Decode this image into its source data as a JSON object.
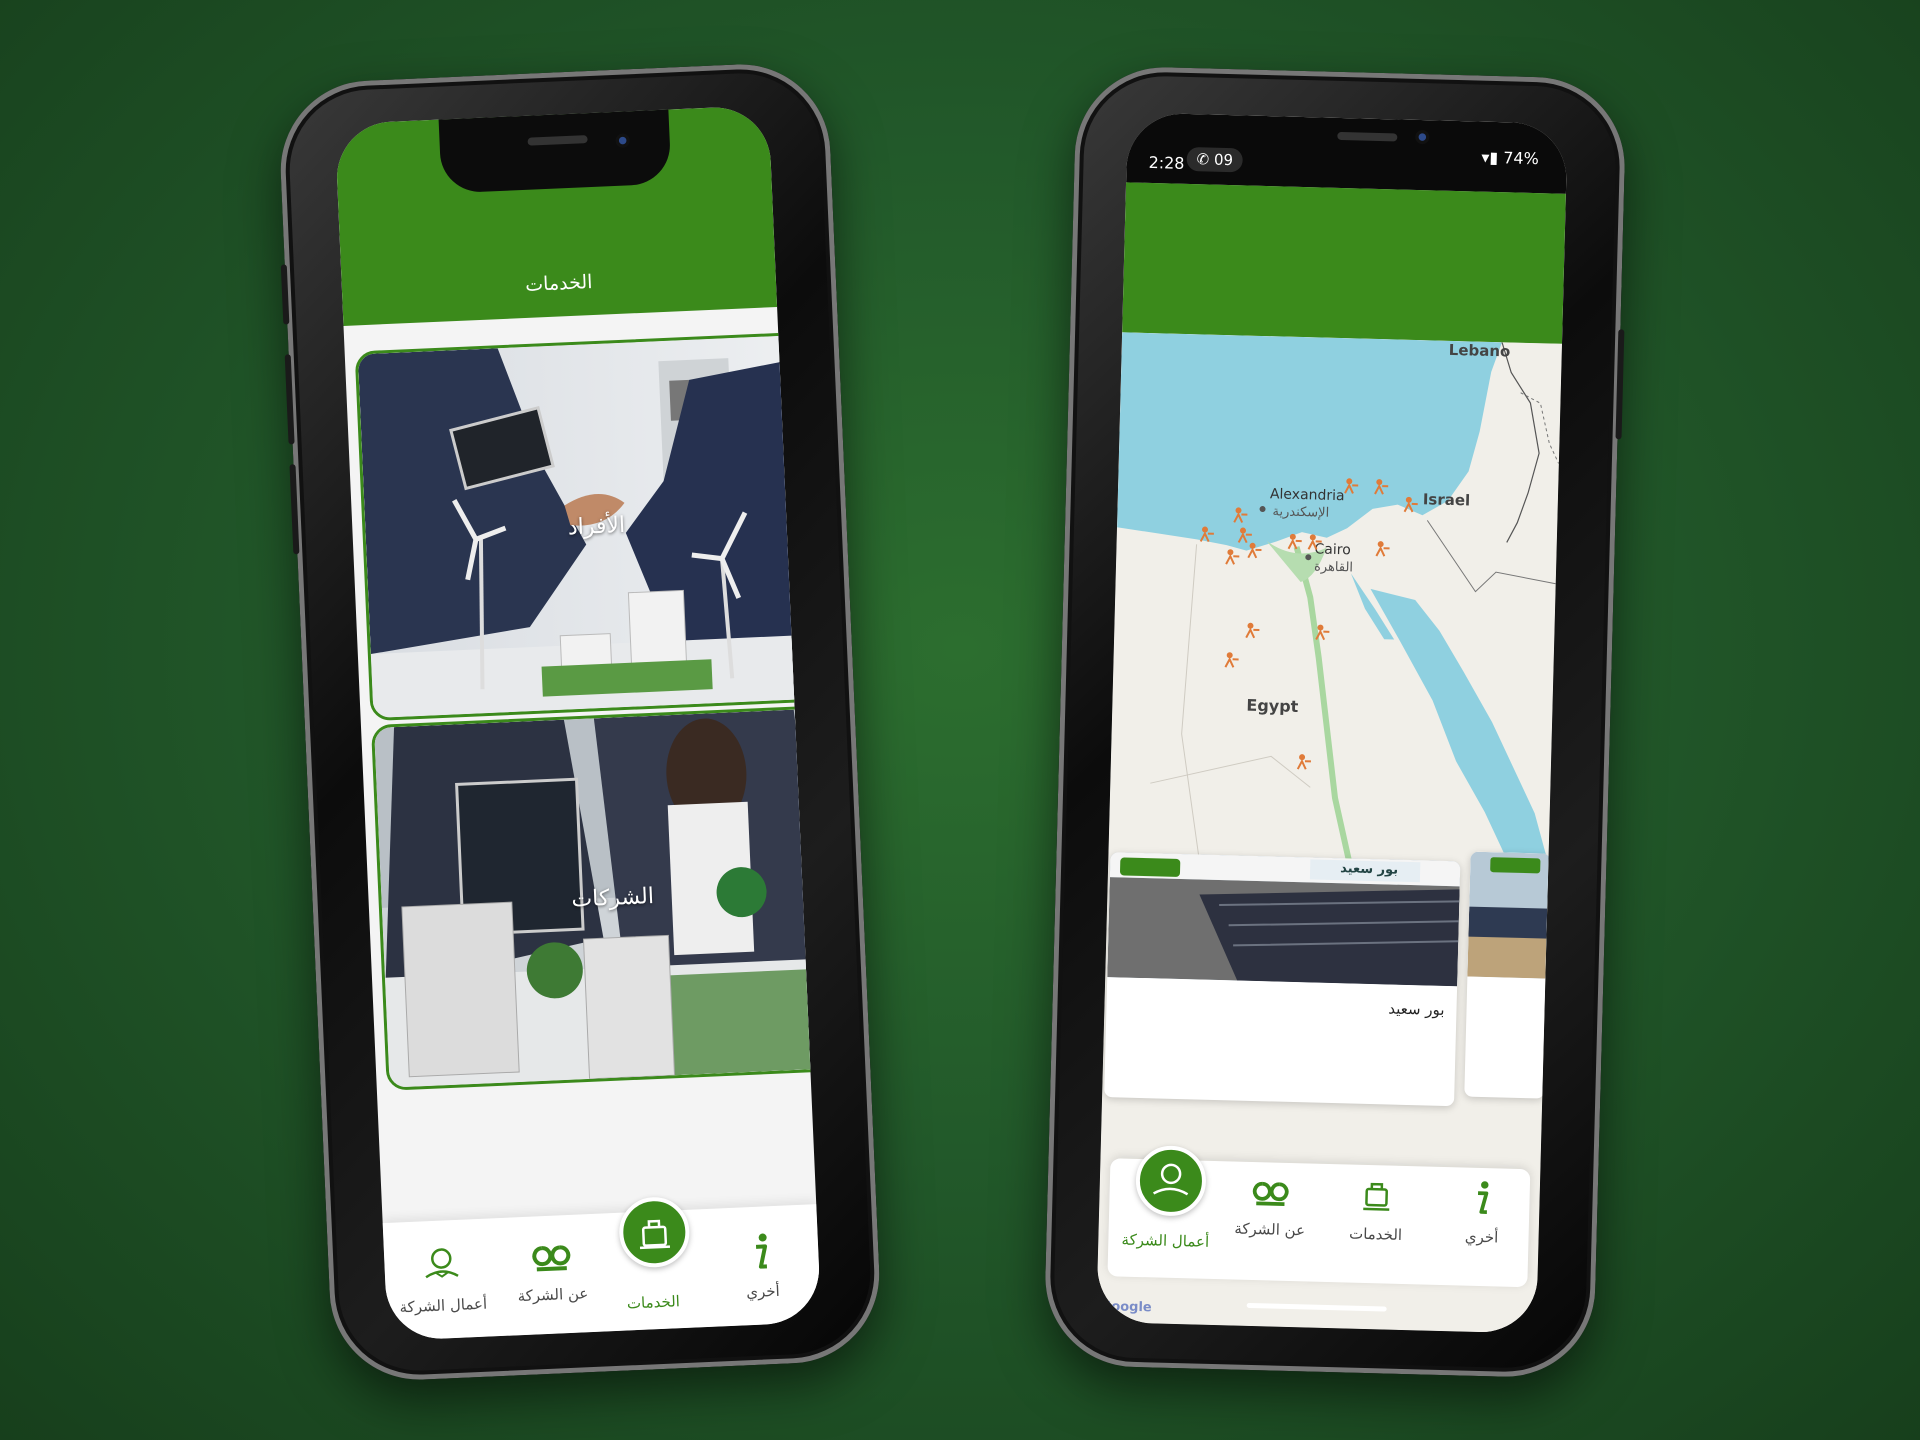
{
  "phone_left": {
    "header_title": "الخدمات",
    "cards": [
      {
        "label": "الأفراد"
      },
      {
        "label": "الشركات"
      }
    ],
    "nav": [
      {
        "label": "أعمال الشركة",
        "icon": "company-works-icon"
      },
      {
        "label": "عن الشركة",
        "icon": "go-solar-logo-icon"
      },
      {
        "label": "الخدمات",
        "icon": "services-icon",
        "active": true
      },
      {
        "label": "أخري",
        "icon": "info-icon"
      }
    ]
  },
  "phone_right": {
    "status": {
      "time": "2:28",
      "call": "09",
      "battery": "74%"
    },
    "map_labels": {
      "lebanon": "Lebano",
      "israel": "Israel",
      "alexandria_en": "Alexandria",
      "alexandria_ar": "الإسكندرية",
      "cairo_en": "Cairo",
      "cairo_ar": "القاهرة",
      "egypt": "Egypt"
    },
    "project_card": {
      "title": "بور سعيد",
      "image_caption": "بور سعيد"
    },
    "nav": [
      {
        "label": "أعمال الشركة",
        "icon": "company-works-icon",
        "active": true
      },
      {
        "label": "عن الشركة",
        "icon": "go-solar-logo-icon"
      },
      {
        "label": "الخدمات",
        "icon": "services-icon"
      },
      {
        "label": "أخري",
        "icon": "info-icon"
      }
    ],
    "map_attribution": "Google"
  },
  "colors": {
    "brand_green": "#3b8a1b",
    "background": "#22592a"
  }
}
